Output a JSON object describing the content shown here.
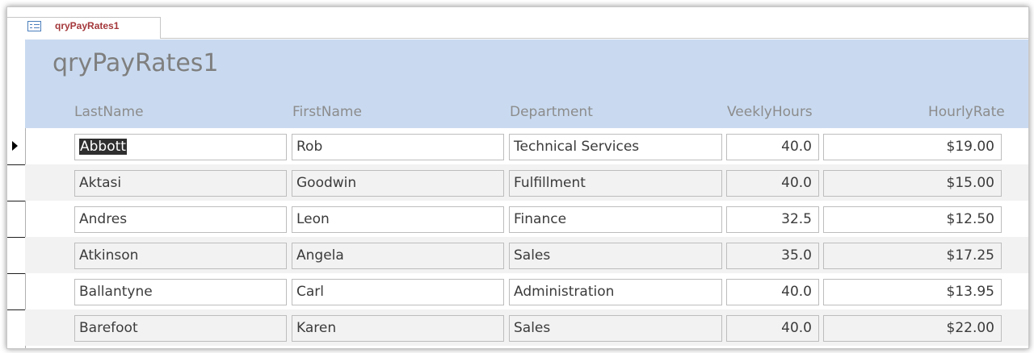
{
  "tab": {
    "label": "qryPayRates1",
    "icon": "form-view-icon"
  },
  "form": {
    "title": "qryPayRates1"
  },
  "columns": {
    "last_name": "LastName",
    "first_name": "FirstName",
    "department": "Department",
    "weekly_hours": "VeeklyHours",
    "hourly_rate": "HourlyRate"
  },
  "records": [
    {
      "last_name": "Abbott",
      "first_name": "Rob",
      "department": "Technical Services",
      "weekly_hours": "40.0",
      "hourly_rate": "$19.00",
      "current": true
    },
    {
      "last_name": "Aktasi",
      "first_name": "Goodwin",
      "department": "Fulfillment",
      "weekly_hours": "40.0",
      "hourly_rate": "$15.00"
    },
    {
      "last_name": "Andres",
      "first_name": "Leon",
      "department": "Finance",
      "weekly_hours": "32.5",
      "hourly_rate": "$12.50"
    },
    {
      "last_name": "Atkinson",
      "first_name": "Angela",
      "department": "Sales",
      "weekly_hours": "35.0",
      "hourly_rate": "$17.25"
    },
    {
      "last_name": "Ballantyne",
      "first_name": "Carl",
      "department": "Administration",
      "weekly_hours": "40.0",
      "hourly_rate": "$13.95"
    },
    {
      "last_name": "Barefoot",
      "first_name": "Karen",
      "department": "Sales",
      "weekly_hours": "40.0",
      "hourly_rate": "$22.00"
    }
  ],
  "colors": {
    "header_bg": "#c9daf0",
    "tab_label": "#a4373a",
    "alt_row_bg": "#f2f2f2",
    "selection_bg": "#2f2f2f"
  }
}
